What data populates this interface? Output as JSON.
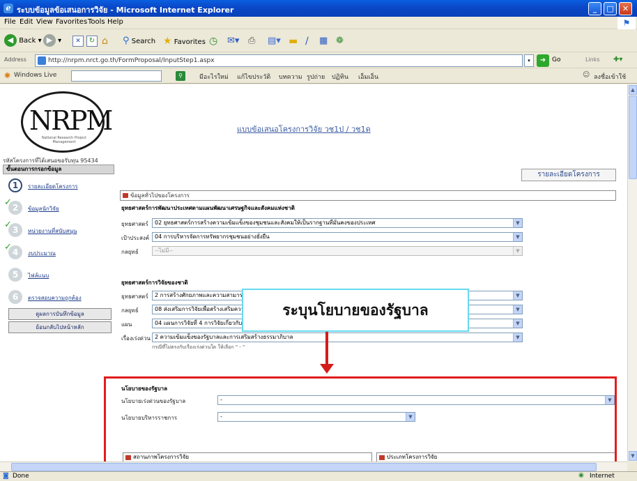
{
  "window": {
    "title": "ระบบข้อมูลข้อเสนอการวิจัย - Microsoft Internet Explorer",
    "minimize": "_",
    "maximize": "□",
    "close": "✕"
  },
  "menu": [
    "File",
    "Edit",
    "View",
    "Favorites",
    "Tools",
    "Help"
  ],
  "toolbar": {
    "back": "Back",
    "search": "Search",
    "favorites": "Favorites"
  },
  "address": {
    "label": "Address",
    "url": "http://nrpm.nrct.go.th/FormProposal/InputStep1.aspx",
    "go": "Go",
    "links": "Links"
  },
  "livebar": {
    "label": "Windows Live",
    "items": [
      "มีอะไรใหม่",
      "แก้ไขประวัติ",
      "บทความ",
      "รูปถ่าย",
      "ปฏิทิน",
      "เอ็มเอ็น"
    ],
    "signin": "ลงชื่อเข้าใช้"
  },
  "page": {
    "logo_text": "NRPM",
    "logo_tagline": "National Research Project Management",
    "title": "แบบข้อเสนอโครงการวิจัย วช1ป / วช1ด",
    "project_code": "รหัสโครงการที่ได้เสนอขอรับทุน 95434",
    "detail_tab": "รายละเอียดโครงการ"
  },
  "nav": {
    "header": "ขั้นตอนการกรอกข้อมูล",
    "items": [
      {
        "num": "1",
        "label": "รายละเอียดโครงการ",
        "checked": false,
        "active": true
      },
      {
        "num": "2",
        "label": "ข้อมูลนักวิจัย",
        "checked": true,
        "active": false
      },
      {
        "num": "3",
        "label": "หน่วยงานที่สนับสนุน",
        "checked": true,
        "active": false
      },
      {
        "num": "4",
        "label": "งบประมาณ",
        "checked": true,
        "active": false
      },
      {
        "num": "5",
        "label": "ไฟล์แนบ",
        "checked": false,
        "active": false
      },
      {
        "num": "6",
        "label": "ตรวจสอบความถูกต้อง",
        "checked": false,
        "active": false
      }
    ],
    "buttons": [
      "ดูผลการบันทึกข้อมูล",
      "ย้อนกลับไปหน้าหลัก"
    ]
  },
  "form": {
    "section1_header": "ข้อมูลทั่วไปของโครงการ",
    "plan_heading": "ยุทธศาสตร์การพัฒนาประเทศตามแผนพัฒนาเศรษฐกิจและสังคมแห่งชาติ",
    "plan_fields": [
      {
        "label": "ยุทธศาสตร์",
        "value": "02 ยุทธศาสตร์การสร้างความเข้มแข็งของชุมชนและสังคมให้เป็นรากฐานที่มั่นคงของประเทศ",
        "disabled": false
      },
      {
        "label": "เป้าประสงค์",
        "value": "04 การบริหารจัดการทรัพยากรชุมชนอย่างยั่งยืน",
        "disabled": false
      },
      {
        "label": "กลยุทธ์",
        "value": "--ไม่มี--",
        "disabled": true
      }
    ],
    "research_heading": "ยุทธศาสตร์การวิจัยของชาติ",
    "research_fields": [
      {
        "label": "ยุทธศาสตร์",
        "value": "2 การสร้างศักยภาพและความสามารถเพื่อการพัฒนาทางเศรษฐกิจ"
      },
      {
        "label": "กลยุทธ์",
        "value": "08 ส่งเสริมการวิจัยเพื่อสร้างเสริมความรู้"
      },
      {
        "label": "แผน",
        "value": "04 แผนการวิจัยที่ 4 การวิจัยเกี่ยวกับการพัฒนาองค์ความรู้ด้านประชาสังคมและการจัดการ"
      },
      {
        "label": "เรื่องเร่งด่วน",
        "value": "2 ความเข้มแข็งของรัฐบาลและการเสริมสร้างธรรมาภิบาล"
      }
    ],
    "research_note": "กรณีที่ไม่ตรงกับเรื่องเร่งด่วนใด ให้เลือก \" - \"",
    "policy_heading": "นโยบายของรัฐบาล",
    "policy_fields": [
      {
        "label": "นโยบายเร่งด่วนของรัฐบาล",
        "value": "-"
      },
      {
        "label": "นโยบายบริหารราชการ",
        "value": "-"
      }
    ],
    "bottom_headers": [
      "สถานภาพโครงการวิจัย",
      "ประเภทโครงการวิจัย"
    ]
  },
  "callout": {
    "text": "ระบุนโยบายของรัฐบาล"
  },
  "status": {
    "left": "Done",
    "right": "Internet"
  },
  "colors": {
    "titlebar": "#0a49c9",
    "highlight_box": "#e21c1c",
    "callout_border": "#66d9ee"
  }
}
